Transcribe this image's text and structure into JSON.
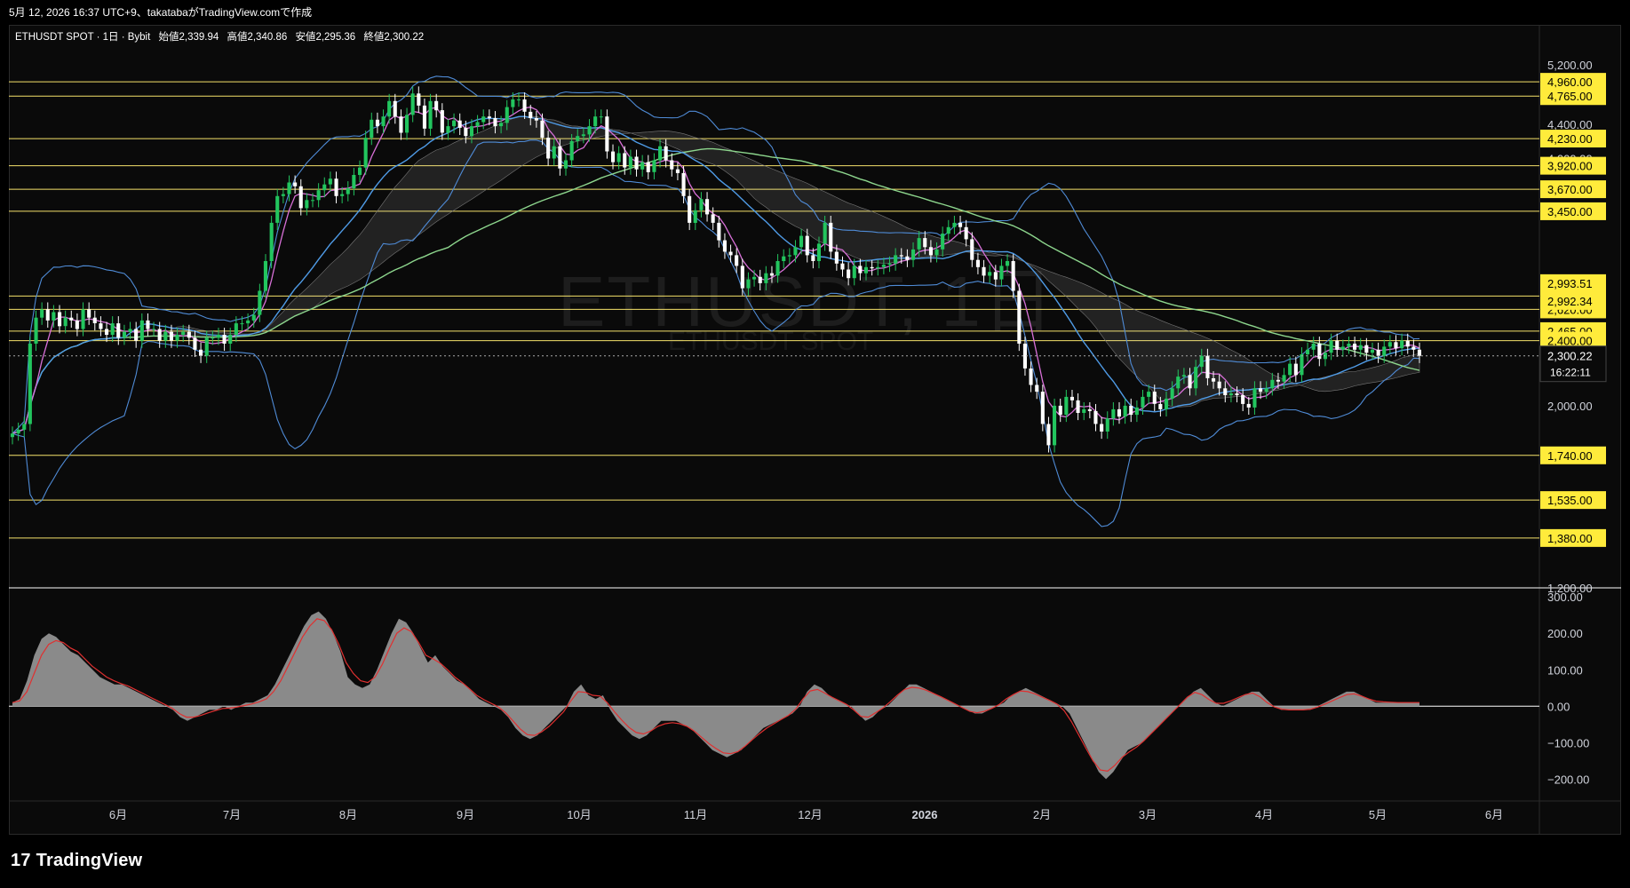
{
  "header": {
    "timestamp_line": "5月 12, 2026 16:37 UTC+9、takatabaがTradingView.comで作成"
  },
  "legend": {
    "symbol": "ETHUSDT SPOT · 1日 · Bybit",
    "open_label": "始値",
    "open": "2,339.94",
    "high_label": "高値",
    "high": "2,340.86",
    "low_label": "安値",
    "low": "2,295.36",
    "close_label": "終値",
    "close": "2,300.22"
  },
  "watermark": {
    "main": "ETHUSDT, 1日",
    "sub": "ETHUSDT SPOT"
  },
  "brand": {
    "name": "TradingView",
    "mark": "17"
  },
  "colors": {
    "background": "#0a0a0a",
    "up": "#22c55e",
    "down": "#ffffff",
    "hline": "#f5e26a",
    "price_tag_bg": "#ffeb3b",
    "bollinger": "#4f8bd6",
    "ma_short": "#d870d8",
    "ma_mid": "#4f9be6",
    "ma_long": "#8dd68d",
    "macd_hist": "#8a8a8a",
    "macd_signal": "#e03030"
  },
  "chart_data": {
    "type": "candlestick",
    "symbol": "ETHUSDT SPOT",
    "timeframe": "1日",
    "exchange": "Bybit",
    "y_scale": "log",
    "ylim": [
      1200,
      5400
    ],
    "price_ticks": [
      "5,200.00",
      "4,400.00",
      "4,000.00",
      "2,000.00",
      "1,200.00"
    ],
    "horizontal_levels": [
      {
        "value": 4960,
        "label": "4,960.00"
      },
      {
        "value": 4765,
        "label": "4,765.00"
      },
      {
        "value": 4230,
        "label": "4,230.00"
      },
      {
        "value": 3920,
        "label": "3,920.00"
      },
      {
        "value": 3670,
        "label": "3,670.00"
      },
      {
        "value": 3450,
        "label": "3,450.00"
      },
      {
        "value": 2720,
        "label": "2,720.00"
      },
      {
        "value": 2620,
        "label": "2,620.00"
      },
      {
        "value": 2465,
        "label": "2,465.00"
      },
      {
        "value": 2400,
        "label": "2,400.00"
      },
      {
        "value": 1740,
        "label": "1,740.00"
      },
      {
        "value": 1535,
        "label": "1,535.00"
      },
      {
        "value": 1380,
        "label": "1,380.00"
      }
    ],
    "indicator_tags": [
      {
        "value": 2993.51,
        "label": "2,993.51"
      },
      {
        "value": 2992.34,
        "label": "2,992.34"
      }
    ],
    "last_price": {
      "value": 2300.22,
      "label": "2,300.22",
      "countdown": "16:22:11"
    },
    "x_labels": [
      "6月",
      "7月",
      "8月",
      "9月",
      "10月",
      "11月",
      "12月",
      "2026",
      "2月",
      "3月",
      "4月",
      "5月",
      "6月"
    ],
    "close_series": [
      1850,
      1870,
      1900,
      2380,
      2560,
      2620,
      2540,
      2600,
      2500,
      2560,
      2540,
      2480,
      2620,
      2560,
      2520,
      2480,
      2440,
      2520,
      2420,
      2460,
      2480,
      2400,
      2540,
      2480,
      2480,
      2400,
      2460,
      2400,
      2440,
      2460,
      2420,
      2340,
      2300,
      2420,
      2420,
      2440,
      2380,
      2440,
      2520,
      2520,
      2540,
      2580,
      2760,
      3000,
      3340,
      3600,
      3620,
      3740,
      3700,
      3480,
      3560,
      3560,
      3660,
      3720,
      3780,
      3600,
      3620,
      3680,
      3820,
      3900,
      4240,
      4460,
      4380,
      4500,
      4700,
      4500,
      4300,
      4520,
      4800,
      4640,
      4350,
      4700,
      4580,
      4300,
      4380,
      4450,
      4360,
      4260,
      4380,
      4430,
      4500,
      4480,
      4380,
      4420,
      4620,
      4720,
      4720,
      4560,
      4480,
      4450,
      4240,
      4000,
      4140,
      3890,
      3980,
      4200,
      4260,
      4280,
      4380,
      4500,
      4500,
      4080,
      3960,
      4060,
      3900,
      4020,
      3880,
      3960,
      3850,
      3980,
      4140,
      3980,
      3880,
      3840,
      3600,
      3340,
      3460,
      3570,
      3420,
      3340,
      3180,
      3080,
      3050,
      2960,
      2780,
      2850,
      2870,
      2820,
      2900,
      2880,
      3000,
      3040,
      3050,
      3120,
      3220,
      3050,
      3000,
      3150,
      3340,
      3080,
      2980,
      2930,
      2860,
      2960,
      2900,
      2950,
      2940,
      2950,
      2970,
      2980,
      3050,
      3040,
      3010,
      3100,
      3200,
      3120,
      3050,
      3100,
      3240,
      3300,
      3340,
      3300,
      3190,
      3010,
      2950,
      2880,
      2910,
      2850,
      2960,
      3000,
      2760,
      2380,
      2220,
      2120,
      2080,
      1900,
      1790,
      2000,
      1950,
      2050,
      2030,
      1960,
      1980,
      1970,
      1900,
      1860,
      1930,
      1980,
      1940,
      2000,
      1950,
      1990,
      2050,
      2080,
      2010,
      1980,
      2040,
      2100,
      2170,
      2180,
      2100,
      2230,
      2300,
      2160,
      2140,
      2100,
      2060,
      2070,
      2060,
      2010,
      1990,
      2100,
      2080,
      2100,
      2150,
      2140,
      2180,
      2250,
      2180,
      2310,
      2340,
      2380,
      2280,
      2320,
      2400,
      2340,
      2360,
      2380,
      2340,
      2370,
      2320,
      2340,
      2300,
      2360,
      2390,
      2350,
      2400,
      2360,
      2340,
      2300
    ],
    "ma_short_note": "",
    "macd": {
      "ylim": [
        -260,
        320
      ],
      "ticks": [
        "300.00",
        "200.00",
        "100.00",
        "0.00",
        "−100.00",
        "−200.00"
      ],
      "histogram": [
        10,
        20,
        70,
        140,
        185,
        200,
        190,
        170,
        150,
        140,
        120,
        100,
        80,
        70,
        60,
        60,
        50,
        40,
        30,
        20,
        10,
        0,
        -10,
        -30,
        -40,
        -30,
        -20,
        -10,
        -10,
        0,
        -10,
        0,
        10,
        10,
        20,
        30,
        60,
        100,
        140,
        180,
        220,
        250,
        260,
        240,
        200,
        150,
        80,
        60,
        50,
        60,
        100,
        150,
        200,
        240,
        230,
        200,
        160,
        120,
        140,
        110,
        90,
        70,
        60,
        40,
        20,
        10,
        0,
        -10,
        -30,
        -60,
        -80,
        -90,
        -80,
        -60,
        -40,
        -20,
        0,
        40,
        60,
        30,
        20,
        30,
        -10,
        -40,
        -60,
        -80,
        -90,
        -80,
        -60,
        -40,
        -40,
        -40,
        -50,
        -60,
        -80,
        -100,
        -120,
        -130,
        -140,
        -130,
        -120,
        -100,
        -80,
        -60,
        -50,
        -40,
        -30,
        -20,
        0,
        40,
        60,
        50,
        30,
        20,
        10,
        0,
        -20,
        -40,
        -30,
        -10,
        0,
        20,
        40,
        60,
        60,
        50,
        40,
        30,
        20,
        10,
        0,
        -10,
        -20,
        -20,
        -10,
        0,
        10,
        30,
        40,
        50,
        40,
        30,
        20,
        10,
        0,
        -20,
        -60,
        -100,
        -140,
        -180,
        -200,
        -180,
        -150,
        -120,
        -110,
        -100,
        -80,
        -60,
        -40,
        -20,
        0,
        20,
        40,
        50,
        30,
        10,
        0,
        10,
        20,
        30,
        40,
        40,
        20,
        0,
        -10,
        -10,
        -10,
        -10,
        -10,
        0,
        10,
        20,
        30,
        40,
        40,
        30,
        20,
        10,
        10,
        10,
        10,
        10,
        10,
        10
      ],
      "signal": [
        10,
        15,
        40,
        90,
        140,
        170,
        180,
        175,
        160,
        150,
        130,
        110,
        95,
        80,
        70,
        62,
        55,
        45,
        35,
        25,
        15,
        5,
        -5,
        -20,
        -30,
        -30,
        -25,
        -18,
        -12,
        -6,
        -5,
        -2,
        2,
        6,
        12,
        20,
        40,
        70,
        110,
        150,
        190,
        220,
        240,
        235,
        210,
        170,
        120,
        90,
        70,
        65,
        80,
        115,
        160,
        200,
        215,
        205,
        175,
        140,
        130,
        118,
        100,
        80,
        65,
        48,
        30,
        18,
        8,
        -2,
        -18,
        -40,
        -62,
        -78,
        -80,
        -70,
        -55,
        -35,
        -15,
        15,
        40,
        38,
        30,
        28,
        10,
        -15,
        -38,
        -58,
        -72,
        -76,
        -68,
        -55,
        -48,
        -45,
        -48,
        -55,
        -68,
        -85,
        -102,
        -116,
        -128,
        -130,
        -125,
        -110,
        -92,
        -75,
        -60,
        -48,
        -36,
        -25,
        -8,
        20,
        42,
        46,
        36,
        25,
        15,
        5,
        -10,
        -28,
        -30,
        -18,
        -5,
        12,
        30,
        46,
        52,
        50,
        44,
        35,
        26,
        16,
        6,
        -4,
        -14,
        -18,
        -14,
        -6,
        4,
        20,
        32,
        42,
        40,
        34,
        25,
        16,
        6,
        -12,
        -42,
        -78,
        -115,
        -150,
        -175,
        -178,
        -162,
        -140,
        -125,
        -112,
        -95,
        -75,
        -55,
        -35,
        -15,
        5,
        25,
        38,
        32,
        18,
        8,
        8,
        15,
        24,
        32,
        36,
        26,
        10,
        -2,
        -8,
        -10,
        -10,
        -10,
        -8,
        -2,
        6,
        15,
        24,
        32,
        34,
        28,
        20,
        14,
        12,
        11,
        10,
        10,
        10,
        10
      ]
    }
  }
}
